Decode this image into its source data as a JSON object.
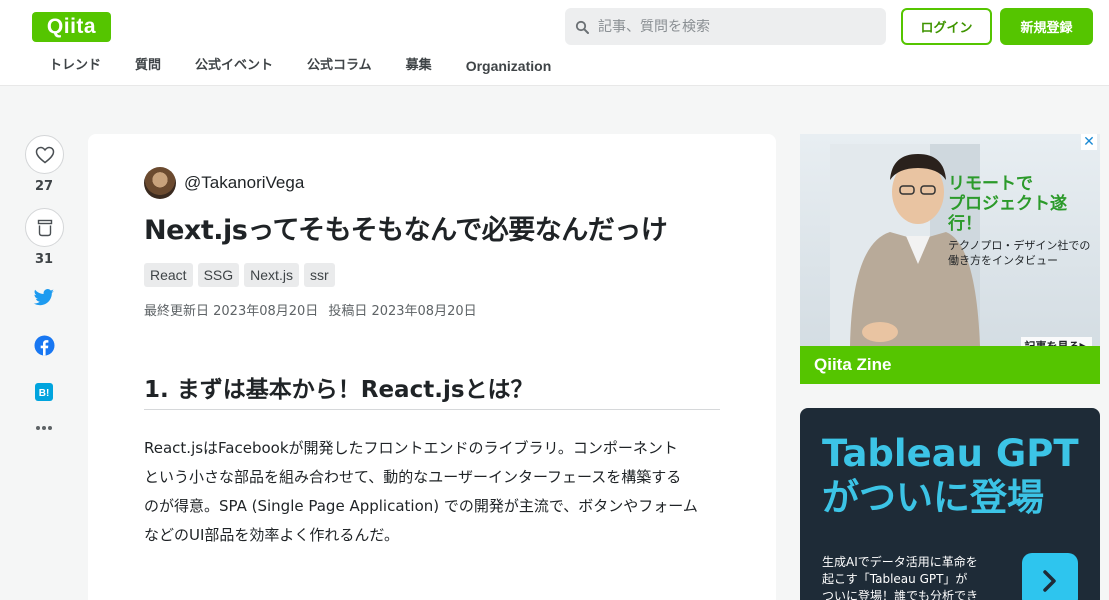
{
  "header": {
    "logo": "Qiita",
    "search_placeholder": "記事、質問を検索",
    "login_label": "ログイン",
    "signup_label": "新規登録",
    "nav": [
      "トレンド",
      "質問",
      "公式イベント",
      "公式コラム",
      "募集",
      "Organization"
    ]
  },
  "actions": {
    "like_count": "27",
    "stock_count": "31"
  },
  "article": {
    "author": "@TakanoriVega",
    "title": "Next.jsってそもそもなんで必要なんだっけ",
    "tags": [
      "React",
      "SSG",
      "Next.js",
      "ssr"
    ],
    "updated": "最終更新日 2023年08月20日",
    "posted": "投稿日 2023年08月20日",
    "section_heading": "1. まずは基本から！React.jsとは？",
    "body_lines": [
      "React.jsはFacebookが開発したフロントエンドのライブラリ。コンポーネント",
      "という小さな部品を組み合わせて、動的なユーザーインターフェースを構築する",
      "のが得意。SPA (Single Page Application) での開発が主流で、ボタンやフォーム",
      "などのUI部品を効率よく作れるんだ。"
    ]
  },
  "ad1": {
    "headline_1": "リモートで",
    "headline_2": "プロジェクト遂行！",
    "sub_1": "テクノプロ・デザイン社での",
    "sub_2": "働き方をインタビュー",
    "more": "記事を見る▶",
    "brand": "Qiita Zine",
    "close": "✕"
  },
  "ad2": {
    "headline_1": "Tableau GPT",
    "headline_2": "がついに登場",
    "sub_1": "生成AIでデータ活用に革命を",
    "sub_2": "起こす「Tableau GPT」が",
    "sub_3": "ついに登場！誰でも分析でき"
  },
  "colors": {
    "brand_green": "#55c500",
    "twitter": "#1d9bf0",
    "facebook": "#1877f2",
    "hatena": "#00a4de"
  }
}
